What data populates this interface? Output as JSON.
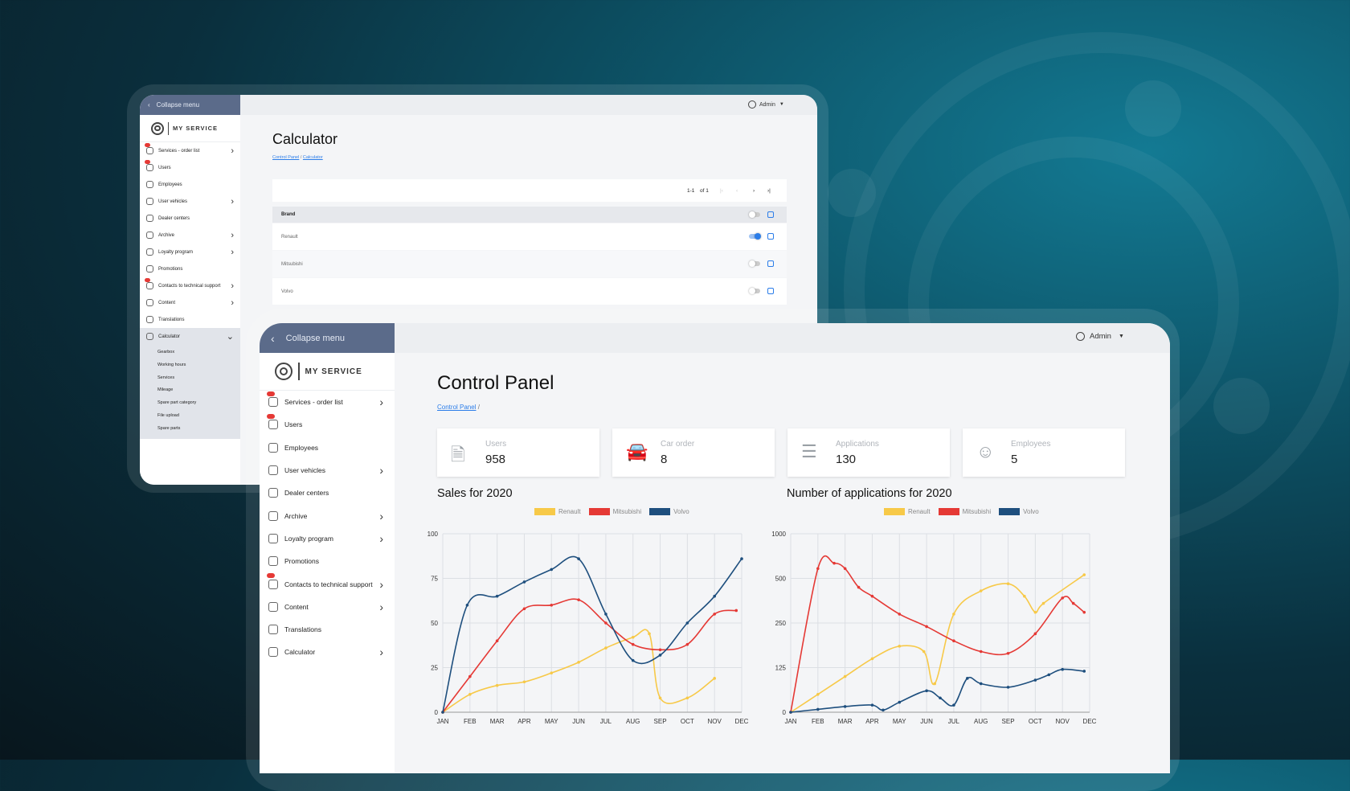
{
  "back_window": {
    "collapse_label": "Collapse menu",
    "admin_label": "Admin",
    "logo_text": "MY SERVICE",
    "nav_items": [
      {
        "label": "Services - order list",
        "chevron": ">",
        "badge": true
      },
      {
        "label": "Users",
        "chevron": "",
        "badge": true
      },
      {
        "label": "Employees",
        "chevron": "",
        "badge": false
      },
      {
        "label": "User vehicles",
        "chevron": ">",
        "badge": false
      },
      {
        "label": "Dealer centers",
        "chevron": "",
        "badge": false
      },
      {
        "label": "Archive",
        "chevron": ">",
        "badge": false
      },
      {
        "label": "Loyalty program",
        "chevron": ">",
        "badge": false
      },
      {
        "label": "Promotions",
        "chevron": "",
        "badge": false
      },
      {
        "label": "Contacts to technical support",
        "chevron": ">",
        "badge": true
      },
      {
        "label": "Content",
        "chevron": ">",
        "badge": false
      },
      {
        "label": "Translations",
        "chevron": "",
        "badge": false
      },
      {
        "label": "Calculator",
        "chevron": "v",
        "badge": false
      }
    ],
    "submenu": [
      "Gearbox",
      "Working hours",
      "Services",
      "Mileage",
      "Spare part category",
      "File upload",
      "Spare parts"
    ],
    "page_title": "Calculator",
    "breadcrumb": {
      "link": "Control Panel",
      "sep": "/",
      "current": "Calculator"
    },
    "pagination": {
      "range": "1-1",
      "of": "of 1"
    },
    "table": {
      "header": "Brand",
      "rows": [
        {
          "name": "Renault",
          "enabled": true
        },
        {
          "name": "Mitsubishi",
          "enabled": false
        },
        {
          "name": "Volvo",
          "enabled": false
        }
      ]
    }
  },
  "front_window": {
    "collapse_label": "Collapse menu",
    "admin_label": "Admin",
    "logo_text": "MY SERVICE",
    "nav_items": [
      {
        "label": "Services - order list",
        "chevron": ">",
        "badge": true
      },
      {
        "label": "Users",
        "chevron": "",
        "badge": true
      },
      {
        "label": "Employees",
        "chevron": "",
        "badge": false
      },
      {
        "label": "User vehicles",
        "chevron": ">",
        "badge": false
      },
      {
        "label": "Dealer centers",
        "chevron": "",
        "badge": false
      },
      {
        "label": "Archive",
        "chevron": ">",
        "badge": false
      },
      {
        "label": "Loyalty program",
        "chevron": ">",
        "badge": false
      },
      {
        "label": "Promotions",
        "chevron": "",
        "badge": false
      },
      {
        "label": "Contacts to technical support",
        "chevron": ">",
        "badge": true
      },
      {
        "label": "Content",
        "chevron": ">",
        "badge": false
      },
      {
        "label": "Translations",
        "chevron": "",
        "badge": false
      },
      {
        "label": "Calculator",
        "chevron": ">",
        "badge": false
      }
    ],
    "page_title": "Control Panel",
    "breadcrumb": {
      "link": "Control Panel",
      "sep": "/"
    },
    "stats": [
      {
        "label": "Users",
        "value": "958",
        "icon": "user-file-icon"
      },
      {
        "label": "Car order",
        "value": "8",
        "icon": "car-icon"
      },
      {
        "label": "Applications",
        "value": "130",
        "icon": "list-check-icon"
      },
      {
        "label": "Employees",
        "value": "5",
        "icon": "employees-icon"
      }
    ]
  },
  "colors": {
    "renault": "#f7c948",
    "mitsubishi": "#e53935",
    "volvo": "#1e4f7e",
    "accent": "#2b7de9",
    "sidebar_header": "#5b6b8a"
  },
  "chart_data": [
    {
      "type": "line",
      "title": "Sales for 2020",
      "categories": [
        "JAN",
        "FEB",
        "MAR",
        "APR",
        "MAY",
        "JUN",
        "JUL",
        "AUG",
        "SEP",
        "OCT",
        "NOV",
        "DEC"
      ],
      "ylim": [
        0,
        100
      ],
      "yticks": [
        "0",
        "25",
        "50",
        "75",
        "100"
      ],
      "grid": true,
      "legend_position": "top",
      "series": [
        {
          "name": "Renault",
          "color": "#f7c948",
          "points": [
            [
              0,
              0
            ],
            [
              1,
              10
            ],
            [
              2,
              15
            ],
            [
              3,
              17
            ],
            [
              4,
              22
            ],
            [
              5,
              28
            ],
            [
              6,
              36
            ],
            [
              7,
              42
            ],
            [
              7.6,
              44
            ],
            [
              8,
              8
            ],
            [
              9,
              8
            ],
            [
              10,
              19
            ]
          ]
        },
        {
          "name": "Mitsubishi",
          "color": "#e53935",
          "points": [
            [
              0,
              0
            ],
            [
              1,
              20
            ],
            [
              2,
              40
            ],
            [
              3,
              58
            ],
            [
              4,
              60
            ],
            [
              5,
              63
            ],
            [
              6,
              50
            ],
            [
              7,
              38
            ],
            [
              8,
              35
            ],
            [
              9,
              38
            ],
            [
              10,
              55
            ],
            [
              10.8,
              57
            ]
          ]
        },
        {
          "name": "Volvo",
          "color": "#1e4f7e",
          "points": [
            [
              0,
              0
            ],
            [
              0.9,
              60
            ],
            [
              2,
              65
            ],
            [
              3,
              73
            ],
            [
              4,
              80
            ],
            [
              5,
              86
            ],
            [
              6,
              55
            ],
            [
              7,
              29
            ],
            [
              8,
              32
            ],
            [
              9,
              50
            ],
            [
              10,
              65
            ],
            [
              11,
              86
            ]
          ]
        }
      ]
    },
    {
      "type": "line",
      "title": "Number of applications for 2020",
      "categories": [
        "JAN",
        "FEB",
        "MAR",
        "APR",
        "MAY",
        "JUN",
        "JUL",
        "AUG",
        "SEP",
        "OCT",
        "NOV",
        "DEC"
      ],
      "ylim": [
        0,
        1000
      ],
      "yticks": [
        "0",
        "125",
        "250",
        "500",
        "1000"
      ],
      "grid": true,
      "legend_position": "top",
      "series": [
        {
          "name": "Renault",
          "color": "#f7c948",
          "points": [
            [
              0,
              0
            ],
            [
              1,
              50
            ],
            [
              2,
              100
            ],
            [
              3,
              150
            ],
            [
              4,
              185
            ],
            [
              4.9,
              170
            ],
            [
              5.3,
              80
            ],
            [
              6,
              300
            ],
            [
              7,
              430
            ],
            [
              8,
              470
            ],
            [
              8.6,
              400
            ],
            [
              9,
              310
            ],
            [
              9.3,
              360
            ],
            [
              10.8,
              540
            ]
          ]
        },
        {
          "name": "Mitsubishi",
          "color": "#e53935",
          "points": [
            [
              0,
              0
            ],
            [
              1,
              610
            ],
            [
              1.6,
              670
            ],
            [
              2,
              610
            ],
            [
              2.5,
              450
            ],
            [
              3,
              400
            ],
            [
              4,
              300
            ],
            [
              5,
              240
            ],
            [
              6,
              200
            ],
            [
              7,
              170
            ],
            [
              8,
              165
            ],
            [
              9,
              220
            ],
            [
              10,
              390
            ],
            [
              10.4,
              360
            ],
            [
              10.8,
              310
            ]
          ]
        },
        {
          "name": "Volvo",
          "color": "#1e4f7e",
          "points": [
            [
              0,
              0
            ],
            [
              1,
              8
            ],
            [
              2,
              16
            ],
            [
              3,
              20
            ],
            [
              3.4,
              6
            ],
            [
              4,
              28
            ],
            [
              5,
              60
            ],
            [
              5.5,
              40
            ],
            [
              6,
              20
            ],
            [
              6.5,
              95
            ],
            [
              7,
              80
            ],
            [
              8,
              70
            ],
            [
              9,
              90
            ],
            [
              9.5,
              105
            ],
            [
              10,
              120
            ],
            [
              10.8,
              115
            ]
          ]
        }
      ]
    }
  ]
}
